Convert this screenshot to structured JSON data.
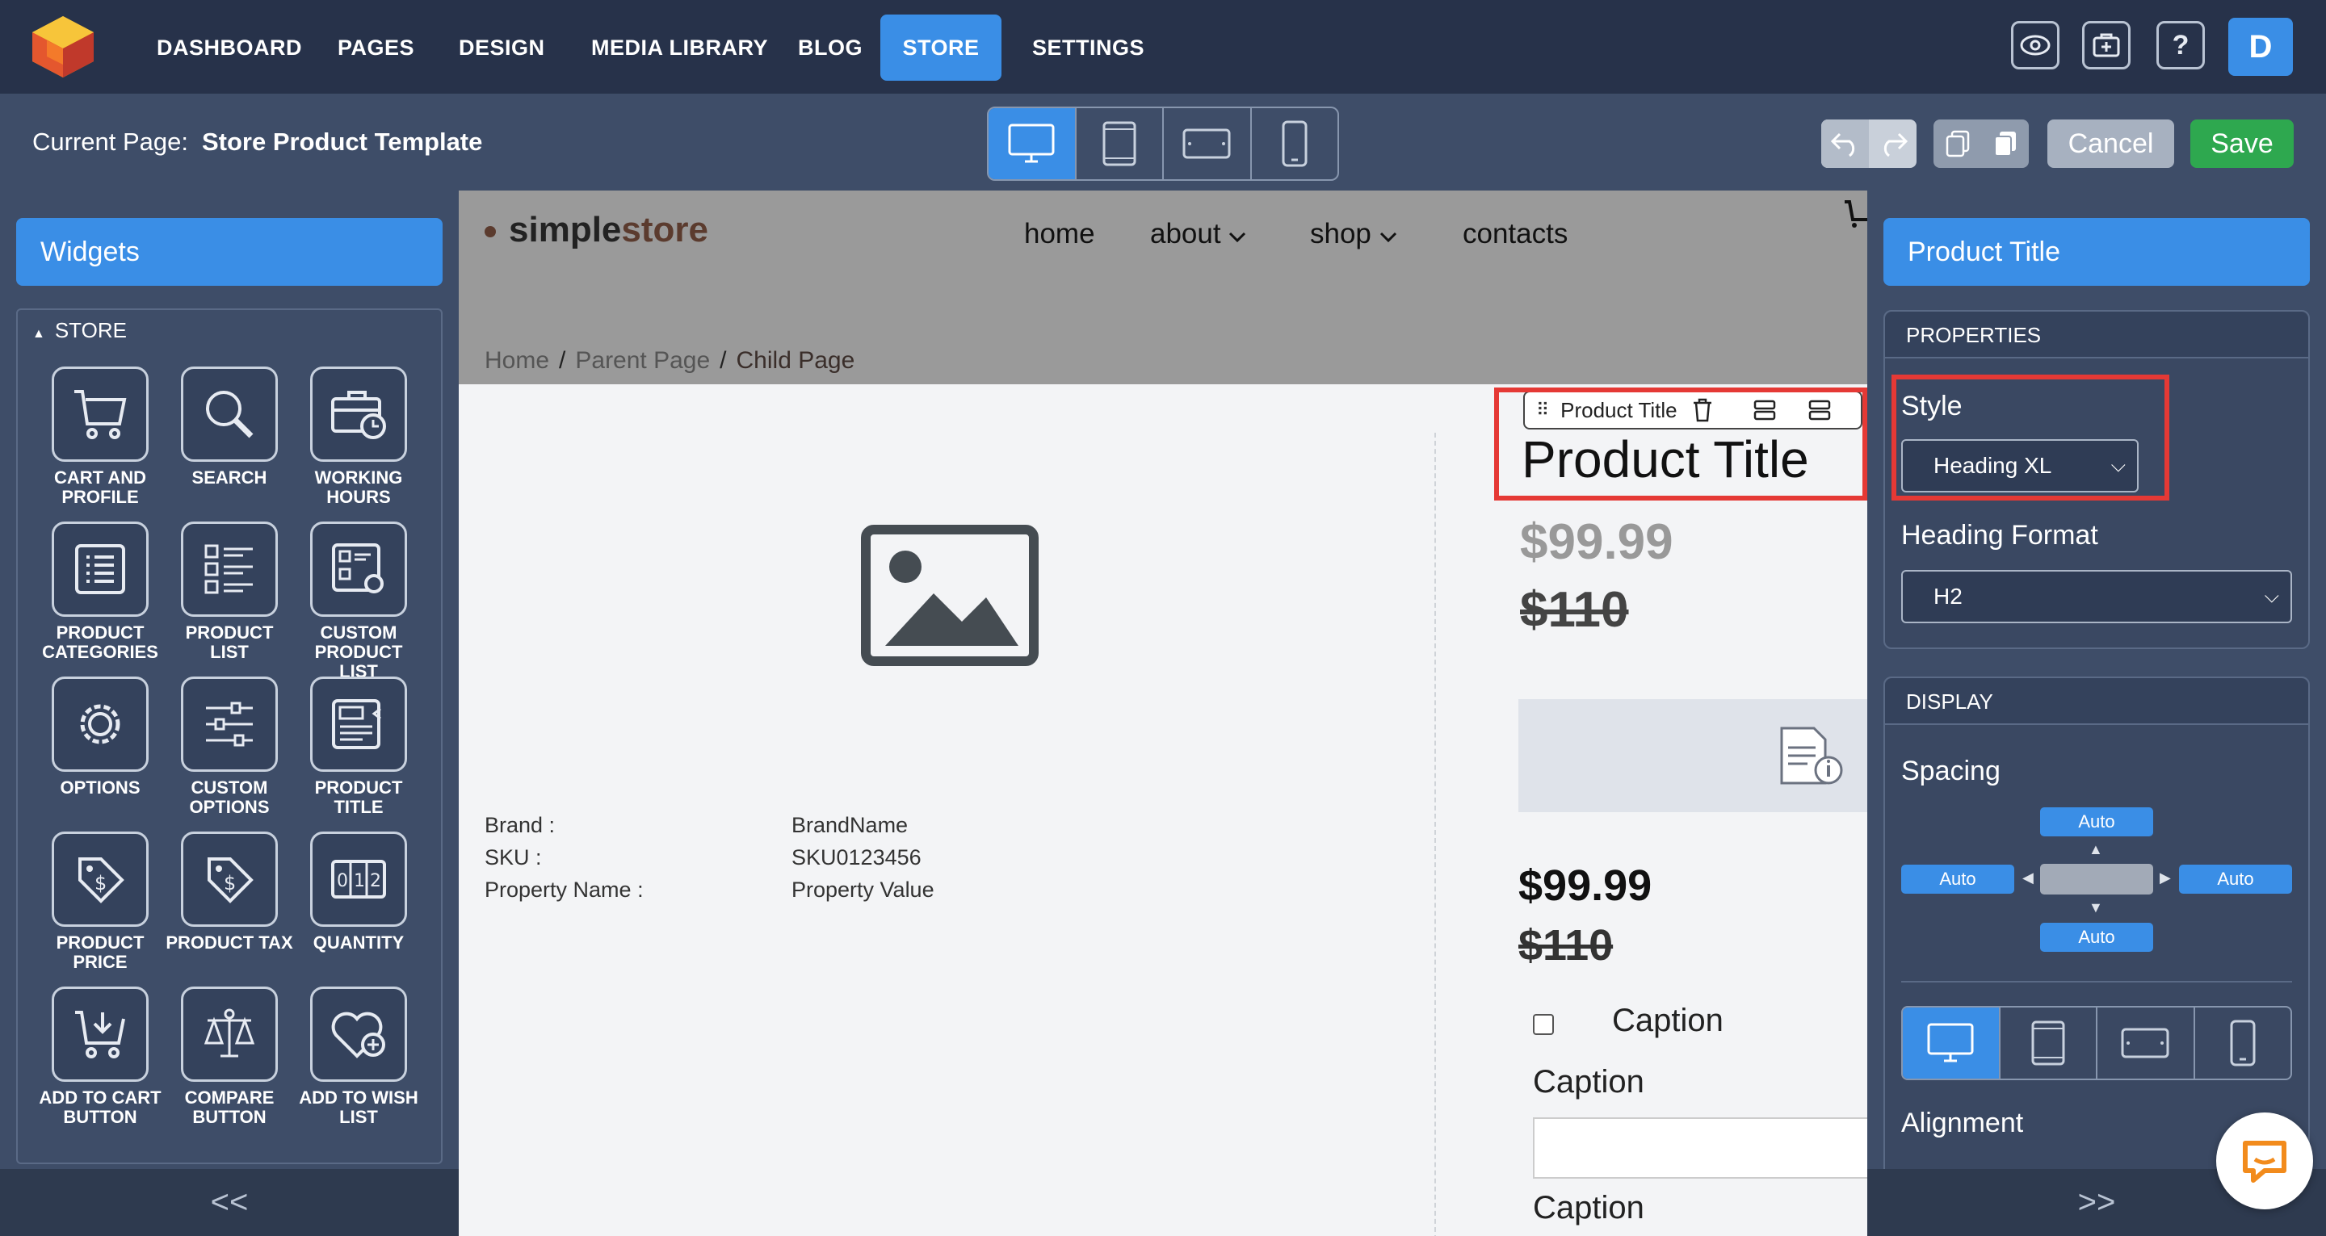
{
  "topnav": {
    "items": [
      "DASHBOARD",
      "PAGES",
      "DESIGN",
      "MEDIA LIBRARY",
      "BLOG",
      "STORE",
      "SETTINGS"
    ],
    "active": "STORE",
    "help_label": "?",
    "avatar_initial": "D"
  },
  "subheader": {
    "current_page_label": "Current Page:",
    "current_page_name": "Store Product Template",
    "cancel_label": "Cancel",
    "save_label": "Save"
  },
  "left_panel": {
    "title": "Widgets",
    "section": "STORE",
    "widgets": [
      {
        "label": "CART AND PROFILE",
        "icon": "cart-icon"
      },
      {
        "label": "SEARCH",
        "icon": "search-icon"
      },
      {
        "label": "WORKING HOURS",
        "icon": "briefcase-clock-icon"
      },
      {
        "label": "PRODUCT CATEGORIES",
        "icon": "list-icon"
      },
      {
        "label": "PRODUCT LIST",
        "icon": "product-list-icon"
      },
      {
        "label": "CUSTOM PRODUCT LIST",
        "icon": "custom-list-icon"
      },
      {
        "label": "OPTIONS",
        "icon": "gear-icon"
      },
      {
        "label": "CUSTOM OPTIONS",
        "icon": "sliders-icon"
      },
      {
        "label": "PRODUCT TITLE",
        "icon": "title-icon"
      },
      {
        "label": "PRODUCT PRICE",
        "icon": "price-tag-icon"
      },
      {
        "label": "PRODUCT TAX",
        "icon": "tax-tag-icon"
      },
      {
        "label": "QUANTITY",
        "icon": "quantity-icon"
      },
      {
        "label": "ADD TO CART BUTTON",
        "icon": "add-to-cart-icon"
      },
      {
        "label": "COMPARE BUTTON",
        "icon": "scale-icon"
      },
      {
        "label": "ADD TO WISH LIST",
        "icon": "heart-plus-icon"
      }
    ],
    "collapse_label": "<<"
  },
  "canvas": {
    "brand_part1": "simple",
    "brand_part2": "store",
    "nav": [
      "home",
      "about",
      "shop",
      "contacts"
    ],
    "breadcrumbs": [
      "Home",
      "Parent Page",
      "Child Page"
    ],
    "properties": [
      {
        "name": "Brand :",
        "value": "BrandName"
      },
      {
        "name": "SKU :",
        "value": "SKU0123456"
      },
      {
        "name": "Property Name :",
        "value": "Property Value"
      }
    ],
    "toolbar_label": "Product Title",
    "product_title": "Product Title",
    "price": "$99.99",
    "old_price": "$110",
    "price2": "$99.99",
    "old_price2": "$110",
    "caption": "Caption"
  },
  "right_panel": {
    "title": "Product Title",
    "properties_section": "PROPERTIES",
    "style_label": "Style",
    "style_value": "Heading XL",
    "heading_format_label": "Heading Format",
    "heading_format_value": "H2",
    "display_section": "DISPLAY",
    "spacing_label": "Spacing",
    "spacing_values": {
      "top": "Auto",
      "left": "Auto",
      "right": "Auto",
      "bottom": "Auto"
    },
    "alignment_label": "Alignment",
    "collapse_label": ">>"
  },
  "colors": {
    "accent": "#3a8ee6",
    "save": "#2ea84f",
    "highlight": "#e53935",
    "nav_bg": "#27324a",
    "panel_bg": "#3e4d68"
  }
}
